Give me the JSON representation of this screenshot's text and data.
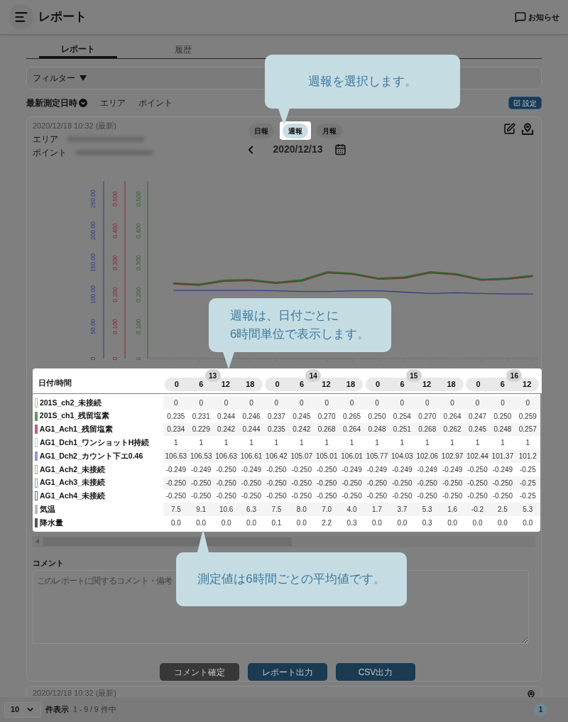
{
  "header": {
    "title": "レポート",
    "notice_label": "お知らせ"
  },
  "tabs": [
    {
      "label": "レポート",
      "selected": true
    },
    {
      "label": "履歴",
      "selected": false
    }
  ],
  "filter": {
    "label": "フィルター"
  },
  "sort_bar": {
    "items": [
      {
        "label": "最新測定日時",
        "selected": true
      },
      {
        "label": "エリア",
        "selected": false
      },
      {
        "label": "ポイント",
        "selected": false
      }
    ],
    "settings_button": "設定"
  },
  "report_card": {
    "timestamp": "2020/12/18 10:32 (最新)",
    "fields": [
      {
        "label": "エリア"
      },
      {
        "label": "ポイント"
      }
    ],
    "periods": [
      {
        "label": "日報",
        "selected": false
      },
      {
        "label": "週報",
        "selected": true
      },
      {
        "label": "月報",
        "selected": false
      }
    ],
    "date": "2020/12/13",
    "chart_data": {
      "type": "line",
      "ylim": [
        0,
        0.556
      ],
      "y2lim": [
        0,
        0.556
      ],
      "y3lim": [
        0,
        278
      ],
      "y2ticks": [
        {
          "value": 0,
          "label": "0"
        },
        {
          "value": 0.1,
          "label": "0.100"
        },
        {
          "value": 0.2,
          "label": "0.200"
        },
        {
          "value": 0.3,
          "label": "0.300"
        },
        {
          "value": 0.4,
          "label": "0.400"
        },
        {
          "value": 0.5,
          "label": "0.500"
        }
      ],
      "y3ticks": [
        {
          "value": 0,
          "label": "0"
        },
        {
          "value": 50,
          "label": "50.00"
        },
        {
          "value": 100,
          "label": "100.00"
        },
        {
          "value": 150,
          "label": "150.00"
        },
        {
          "value": 200,
          "label": "200.00"
        },
        {
          "value": 250,
          "label": "250.00"
        }
      ],
      "yticks": [
        {
          "value": 0,
          "label": "0"
        },
        {
          "value": 0.1,
          "label": "0.100"
        },
        {
          "value": 0.2,
          "label": "0.200"
        },
        {
          "value": 0.3,
          "label": "0.300"
        },
        {
          "value": 0.4,
          "label": "0.400"
        },
        {
          "value": 0.5,
          "label": "0.500"
        }
      ],
      "series": [
        {
          "color": "#2f6a2f",
          "values": [
            0.235,
            0.231,
            0.244,
            0.246,
            0.237,
            0.245,
            0.27,
            0.265,
            0.25,
            0.254,
            0.27,
            0.264,
            0.247,
            0.25,
            0.259
          ]
        },
        {
          "color": "#8a2a3c",
          "axis": "y2",
          "values": [
            0.234,
            0.229,
            0.242,
            0.244,
            0.235,
            0.242,
            0.268,
            0.264,
            0.248,
            0.251,
            0.268,
            0.262,
            0.245,
            0.248,
            0.257
          ]
        },
        {
          "color": "#343c8c",
          "axis": "y3",
          "values": [
            107,
            107,
            107,
            107,
            106,
            105,
            105,
            106,
            106,
            104,
            102,
            103,
            102,
            101,
            101
          ]
        }
      ]
    },
    "table": {
      "corner": "日付/時間",
      "days": [
        {
          "day": "13",
          "hours": [
            "0",
            "6",
            "12",
            "18"
          ]
        },
        {
          "day": "14",
          "hours": [
            "0",
            "6",
            "12",
            "18"
          ]
        },
        {
          "day": "15",
          "hours": [
            "0",
            "6",
            "12",
            "18"
          ]
        },
        {
          "day": "16",
          "hours": [
            "0",
            "6",
            "12"
          ]
        }
      ],
      "rows": [
        {
          "name": "201S_ch2_未接続",
          "color": "#b7c08c",
          "hollow": true,
          "values": [
            "0",
            "0",
            "0",
            "0",
            "0",
            "0",
            "0",
            "0",
            "0",
            "0",
            "0",
            "0",
            "0",
            "0",
            "0"
          ]
        },
        {
          "name": "201S_ch1_残留塩素",
          "color": "#5a9a5a",
          "hollow": false,
          "values": [
            "0.235",
            "0.231",
            "0.244",
            "0.246",
            "0.237",
            "0.245",
            "0.270",
            "0.265",
            "0.250",
            "0.254",
            "0.270",
            "0.264",
            "0.247",
            "0.250",
            "0.259"
          ]
        },
        {
          "name": "AG1_Ach1_残留塩素",
          "color": "#c0607a",
          "hollow": false,
          "values": [
            "0.234",
            "0.229",
            "0.242",
            "0.244",
            "0.235",
            "0.242",
            "0.268",
            "0.264",
            "0.248",
            "0.251",
            "0.268",
            "0.262",
            "0.245",
            "0.248",
            "0.257"
          ]
        },
        {
          "name": "AG1_Dch1_ワンショットH持続",
          "color": "#9ddad6",
          "hollow": true,
          "values": [
            "1",
            "1",
            "1",
            "1",
            "1",
            "1",
            "1",
            "1",
            "1",
            "1",
            "1",
            "1",
            "1",
            "1",
            "1"
          ]
        },
        {
          "name": "AG1_Dch2_カウント下エ0.46",
          "color": "#8a9ae0",
          "hollow": false,
          "values": [
            "106.63",
            "106.53",
            "106.63",
            "106.61",
            "106.42",
            "105.07",
            "105.01",
            "106.01",
            "105.77",
            "104.03",
            "102.06",
            "102.97",
            "102.44",
            "101.37",
            "101.2"
          ]
        },
        {
          "name": "AG1_Ach2_未接続",
          "color": "#a6b070",
          "hollow": true,
          "values": [
            "-0.249",
            "-0.249",
            "-0.250",
            "-0.249",
            "-0.250",
            "-0.250",
            "-0.250",
            "-0.249",
            "-0.249",
            "-0.249",
            "-0.249",
            "-0.249",
            "-0.250",
            "-0.249",
            "-0.25"
          ]
        },
        {
          "name": "AG1_Ach3_未接続",
          "color": "#66b0b0",
          "hollow": true,
          "values": [
            "-0.250",
            "-0.250",
            "-0.250",
            "-0.250",
            "-0.250",
            "-0.250",
            "-0.250",
            "-0.250",
            "-0.250",
            "-0.250",
            "-0.250",
            "-0.250",
            "-0.250",
            "-0.250",
            "-0.25"
          ]
        },
        {
          "name": "AG1_Ach4_未接続",
          "color": "#5a6a9a",
          "hollow": true,
          "values": [
            "-0.250",
            "-0.250",
            "-0.250",
            "-0.250",
            "-0.250",
            "-0.250",
            "-0.250",
            "-0.250",
            "-0.250",
            "-0.250",
            "-0.250",
            "-0.250",
            "-0.250",
            "-0.250",
            "-0.25"
          ]
        },
        {
          "name": "気温",
          "color": "#bbbbbb",
          "hollow": false,
          "values": [
            "7.5",
            "9.1",
            "10.6",
            "6.3",
            "7.5",
            "8.0",
            "7.0",
            "4.0",
            "1.7",
            "3.7",
            "5.3",
            "1.6",
            "-0.2",
            "2.5",
            "5.3"
          ]
        },
        {
          "name": "降水量",
          "color": "#555555",
          "hollow": false,
          "values": [
            "0.0",
            "0.0",
            "0.0",
            "0.0",
            "0.1",
            "0.0",
            "2.2",
            "0.3",
            "0.0",
            "0.0",
            "0.3",
            "0.0",
            "0.0",
            "0.0",
            "0.0"
          ]
        }
      ]
    },
    "comment": {
      "label": "コメント",
      "placeholder": "このレポートに関するコメント・備考"
    },
    "buttons": [
      {
        "label": "コメント確定",
        "kind": "secondary"
      },
      {
        "label": "レポート出力",
        "kind": "primary"
      },
      {
        "label": "CSV出力",
        "kind": "primary"
      }
    ]
  },
  "next_card": {
    "timestamp": "2020/12/18 10:32 (最新)"
  },
  "footer": {
    "page_size": "10",
    "page_size_label": "件表示",
    "range": "1 - 9 / 9 件中",
    "pages": [
      {
        "label": "1",
        "selected": true
      }
    ]
  },
  "tooltips": [
    {
      "text": "週報を選択します。",
      "kind": "down"
    },
    {
      "text": "週報は、日付ごとに\n6時間単位で表示します。",
      "kind": "down"
    },
    {
      "text": "測定値は6時間ごとの平均値です。",
      "kind": "up"
    }
  ]
}
